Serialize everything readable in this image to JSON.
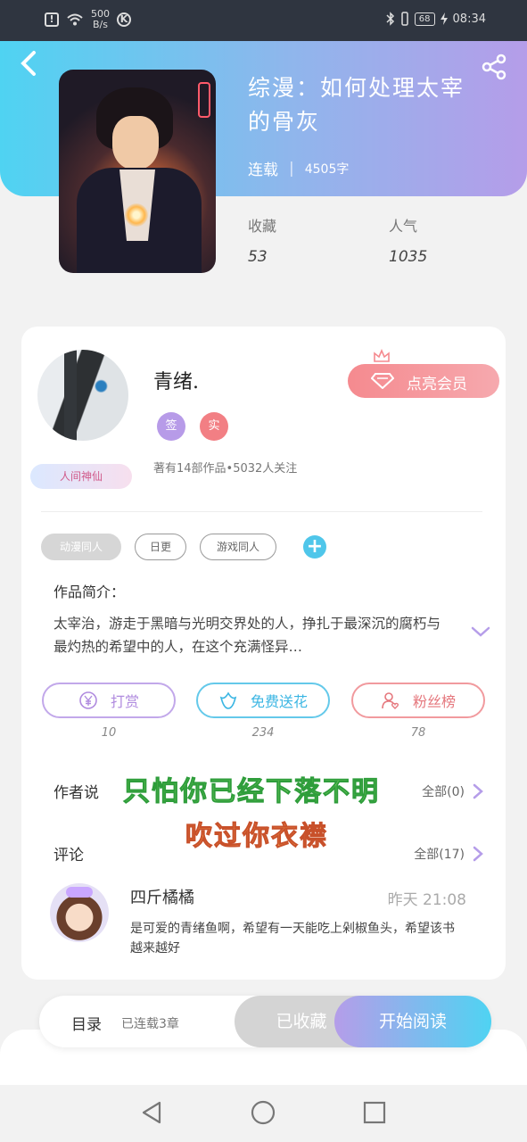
{
  "status_bar": {
    "speed_value": "500",
    "speed_unit": "B/s",
    "battery": "68",
    "time": "08:34",
    "icons": [
      "alert-icon",
      "wifi-icon",
      "k-icon",
      "bluetooth-icon",
      "vibrate-icon",
      "charging-icon"
    ]
  },
  "book": {
    "title": "综漫：如何处理太宰的骨灰",
    "status": "连载",
    "word_count": "4505字",
    "stats": [
      {
        "label": "收藏",
        "value": "53"
      },
      {
        "label": "人气",
        "value": "1035"
      }
    ]
  },
  "author": {
    "name": "青绪.",
    "badges": [
      "签",
      "实"
    ],
    "avatar_badge": "人间神仙",
    "meta": "著有14部作品•5032人关注",
    "vip_button": "点亮会员"
  },
  "tags": [
    "动漫同人",
    "日更",
    "游戏同人"
  ],
  "intro": {
    "heading": "作品简介：",
    "text": "太宰治，游走于黑暗与光明交界处的人，挣扎于最深沉的腐朽与最灼热的希望中的人，在这个充满怪异…"
  },
  "actions": [
    {
      "label": "打赏",
      "count": "10",
      "icon": "yen-icon"
    },
    {
      "label": "免费送花",
      "count": "234",
      "icon": "flower-icon"
    },
    {
      "label": "粉丝榜",
      "count": "78",
      "icon": "fans-icon"
    }
  ],
  "author_says": {
    "title": "作者说",
    "all": "全部(0)"
  },
  "comments": {
    "title": "评论",
    "all": "全部(17)",
    "items": [
      {
        "name": "四斤橘橘",
        "time": "昨天 21:08",
        "text": "是可爱的青绪鱼啊，希望有一天能吃上剁椒鱼头，希望该书越来越好"
      }
    ]
  },
  "overlay_text": {
    "line1": "只怕你已经下落不明",
    "line2": "吹过你衣襟"
  },
  "bottom": {
    "toc": "目录",
    "toc_sub": "已连载3章",
    "collected": "已收藏",
    "read": "开始阅读"
  },
  "colors": {
    "header_start": "#4fd3f2",
    "header_end": "#b59de9",
    "vip": "#f58a8f",
    "accent_blue": "#4fc6ea"
  }
}
